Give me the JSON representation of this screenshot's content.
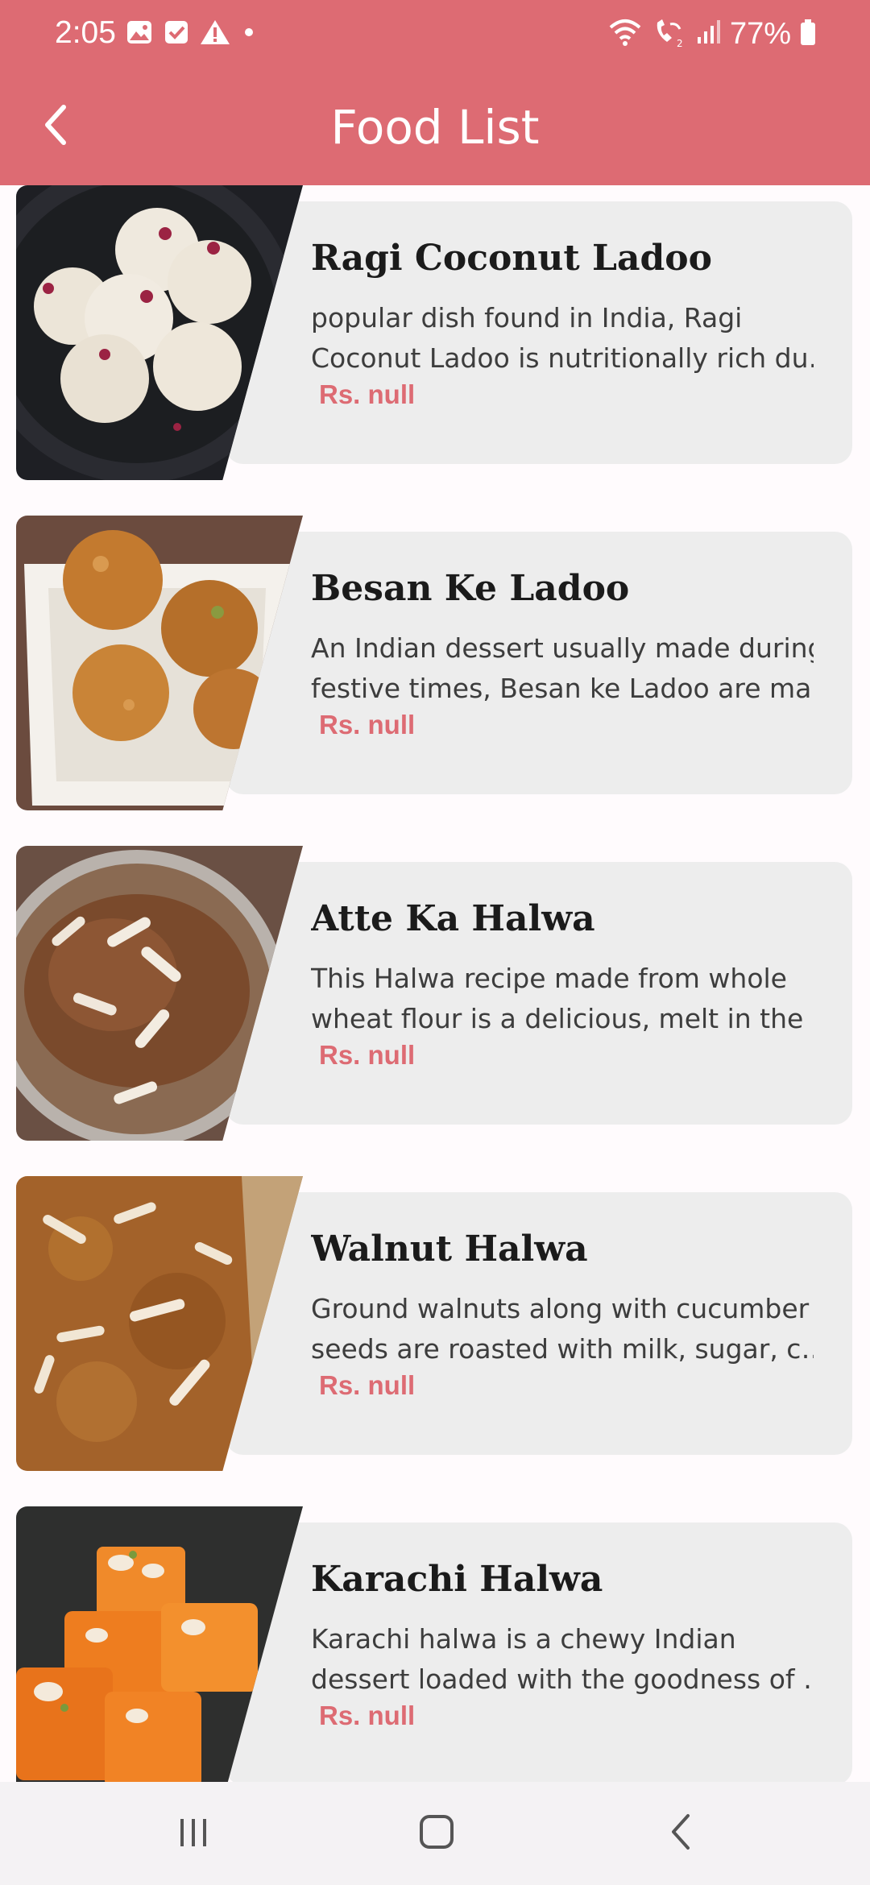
{
  "status_bar": {
    "time": "2:05",
    "battery": "77%",
    "icons": [
      "gallery-icon",
      "checkbox-icon",
      "warning-icon",
      "dot-icon",
      "wifi-icon",
      "wifi-calling-icon",
      "signal-icon",
      "battery-icon"
    ]
  },
  "header": {
    "title": "Food List",
    "back_icon": "back-arrow-icon",
    "background": "#dd6b73"
  },
  "foods": [
    {
      "name": "Ragi Coconut Ladoo",
      "desc_line1": "popular dish found in India, Ragi",
      "desc_line2": "Coconut Ladoo is nutritionally rich du…",
      "price": "Rs. null"
    },
    {
      "name": "Besan Ke Ladoo",
      "desc_line1": "An Indian dessert usually made during",
      "desc_line2": "festive times, Besan ke Ladoo are ma…",
      "price": "Rs. null"
    },
    {
      "name": "Atte Ka Halwa",
      "desc_line1": "This Halwa recipe made from whole",
      "desc_line2": "wheat flour is a delicious, melt in the …",
      "price": "Rs. null"
    },
    {
      "name": "Walnut Halwa",
      "desc_line1": "Ground walnuts along with cucumber",
      "desc_line2": "seeds are roasted with milk, sugar, c…",
      "price": "Rs. null"
    },
    {
      "name": "Karachi Halwa",
      "desc_line1": "Karachi halwa is a chewy Indian",
      "desc_line2": "dessert loaded with the goodness of …",
      "price": "Rs. null"
    }
  ],
  "colors": {
    "accent": "#dd6b73",
    "card": "#ededed",
    "price": "#dd6b73"
  },
  "nav_bar": {
    "icons": [
      "recents-icon",
      "home-icon",
      "back-icon"
    ]
  }
}
